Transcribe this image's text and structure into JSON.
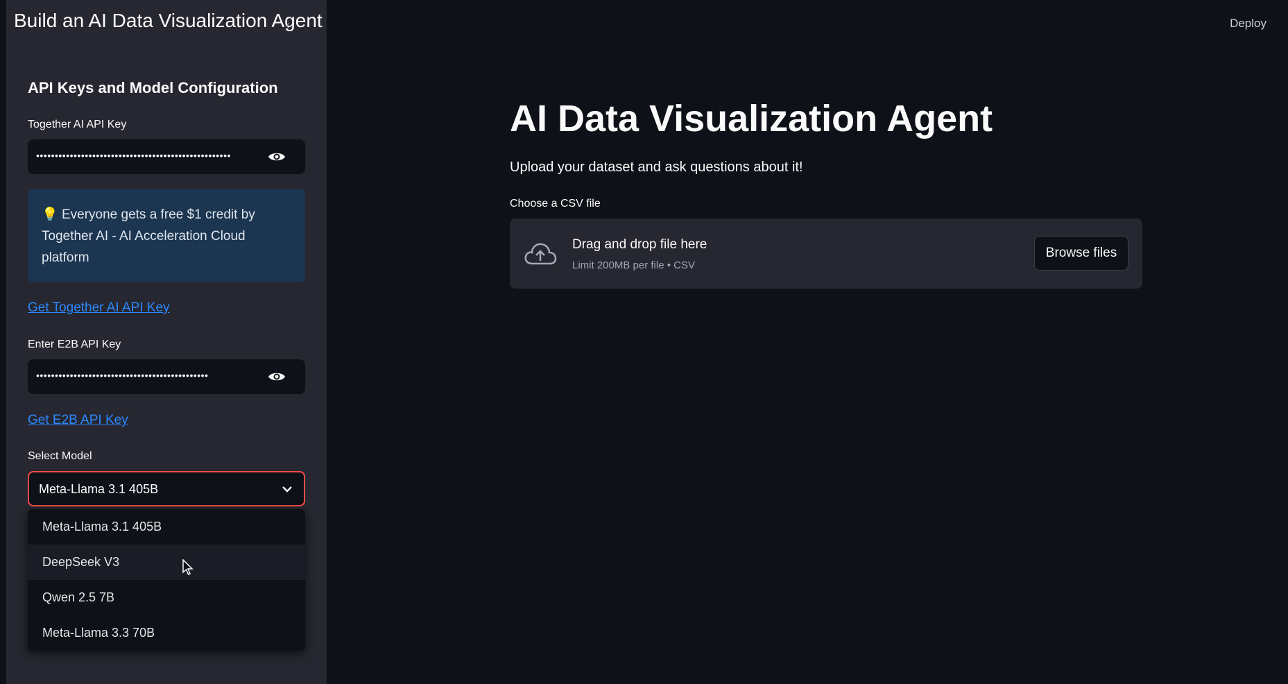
{
  "video": {
    "title": "Build an AI Data Visualization Agent"
  },
  "header": {
    "deploy_label": "Deploy"
  },
  "sidebar": {
    "header": "API Keys and Model Configuration",
    "together_key": {
      "label": "Together AI API Key",
      "value": "••••••••••••••••••••••••••••••••••••••••••••••••••••"
    },
    "info": {
      "icon": "💡",
      "text": "Everyone gets a free $1 credit by Together AI - AI Acceleration Cloud platform"
    },
    "together_link": "Get Together AI API Key",
    "e2b_key": {
      "label": "Enter E2B API Key",
      "value": "••••••••••••••••••••••••••••••••••••••••••••••"
    },
    "e2b_link": "Get E2B API Key",
    "model": {
      "label": "Select Model",
      "selected": "Meta-Llama 3.1 405B",
      "options": [
        "Meta-Llama 3.1 405B",
        "DeepSeek V3",
        "Qwen 2.5 7B",
        "Meta-Llama 3.3 70B"
      ],
      "hovered": "DeepSeek V3"
    }
  },
  "main": {
    "title": "AI Data Visualization Agent",
    "subtitle": "Upload your dataset and ask questions about it!",
    "uploader": {
      "label": "Choose a CSV file",
      "drop_text": "Drag and drop file here",
      "limit_text": "Limit 200MB per file • CSV",
      "browse_label": "Browse files"
    }
  },
  "colors": {
    "background": "#0e1117",
    "sidebar": "#262730",
    "accent_border": "#ff4b4b",
    "link": "#2c89ff",
    "info_bg": "#1c3550"
  },
  "icons": [
    "eye-icon",
    "chevron-down-icon",
    "cloud-upload-icon",
    "mouse-cursor-icon",
    "collapse-chevron-icon"
  ]
}
